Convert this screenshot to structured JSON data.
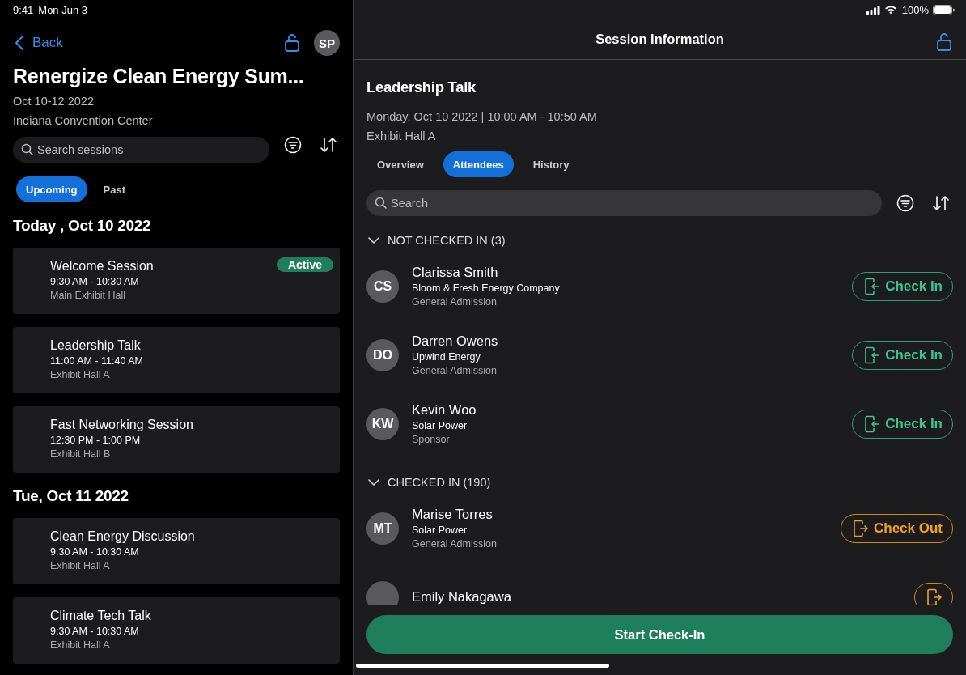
{
  "status_bar": {
    "time": "9:41",
    "date": "Mon Jun 3",
    "battery": "100%"
  },
  "event": {
    "back": "Back",
    "avatar": "SP",
    "title": "Renergize Clean Energy Sum...",
    "dates": "Oct 10-12 2022",
    "venue": "Indiana Convention Center",
    "search": {
      "placeholder": "Search sessions"
    },
    "tabs": [
      {
        "label": "Upcoming",
        "selected": true
      },
      {
        "label": "Past",
        "selected": false
      }
    ],
    "days": [
      {
        "heading": "Today , Oct 10 2022",
        "sessions": [
          {
            "title": "Welcome Session",
            "time": "9:30 AM - 10:30 AM",
            "room": "Main Exhibit Hall",
            "badge": "Active"
          },
          {
            "title": "Leadership Talk",
            "time": "11:00 AM - 11:40 AM",
            "room": "Exhibit Hall A"
          },
          {
            "title": "Fast Networking Session",
            "time": "12:30 PM - 1:00 PM",
            "room": "Exhibit Hall B"
          }
        ]
      },
      {
        "heading": "Tue, Oct 11 2022",
        "sessions": [
          {
            "title": "Clean Energy Discussion",
            "time": "9:30 AM - 10:30 AM",
            "room": "Exhibit Hall A"
          },
          {
            "title": "Climate Tech Talk",
            "time": "9:30 AM - 10:30 AM",
            "room": "Exhibit Hall A"
          }
        ]
      }
    ]
  },
  "session": {
    "nav_title": "Session Information",
    "title": "Leadership Talk",
    "when": "Monday, Oct 10 2022 | 10:00 AM - 10:50 AM",
    "where": "Exhibit Hall A",
    "tabs": [
      {
        "label": "Overview",
        "selected": false
      },
      {
        "label": "Attendees",
        "selected": true
      },
      {
        "label": "History",
        "selected": false
      }
    ],
    "search": {
      "placeholder": "Search"
    },
    "groups": [
      {
        "heading": "NOT CHECKED IN (3)",
        "expanded": true,
        "attendees": [
          {
            "initials": "CS",
            "name": "Clarissa Smith",
            "company": "Bloom & Fresh Energy Company",
            "type": "General Admission",
            "action": "Check In",
            "checked_in": false
          },
          {
            "initials": "DO",
            "name": "Darren Owens",
            "company": "Upwind Energy",
            "type": "General Admission",
            "action": "Check In",
            "checked_in": false
          },
          {
            "initials": "KW",
            "name": "Kevin Woo",
            "company": "Solar Power",
            "type": "Sponsor",
            "action": "Check In",
            "checked_in": false
          }
        ]
      },
      {
        "heading": "CHECKED IN (190)",
        "expanded": true,
        "attendees": [
          {
            "initials": "MT",
            "name": "Marise Torres",
            "company": "Solar Power",
            "type": "General Admission",
            "action": "Check Out",
            "checked_in": true
          },
          {
            "name": "Emily Nakagawa",
            "checked_in": true
          }
        ]
      }
    ],
    "primary_button": "Start Check-In"
  }
}
